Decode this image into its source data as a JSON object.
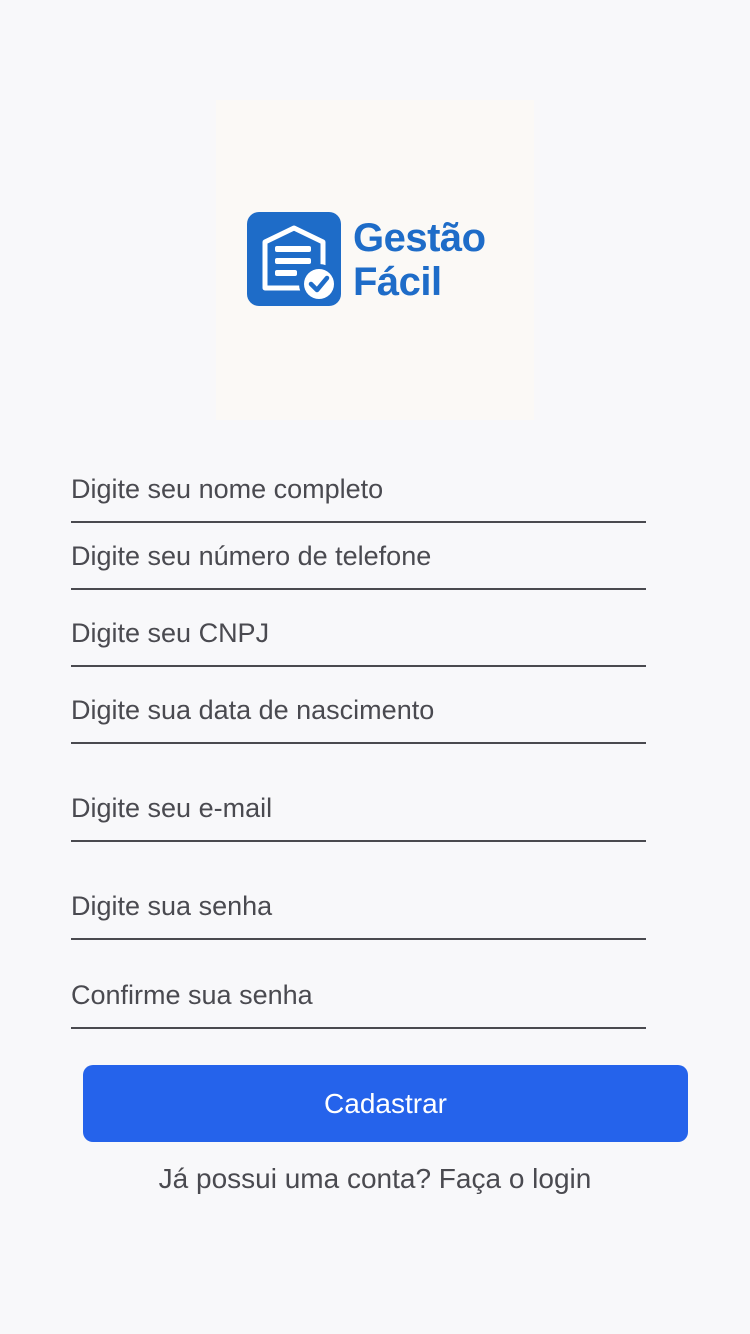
{
  "brand": {
    "name_line1": "Gestão",
    "name_line2": "Fácil",
    "color": "#1e6cc8",
    "icon": "document-check-icon"
  },
  "form": {
    "fields": [
      {
        "placeholder": "Digite seu nome completo",
        "value": ""
      },
      {
        "placeholder": "Digite seu número de telefone",
        "value": ""
      },
      {
        "placeholder": "Digite seu CNPJ",
        "value": ""
      },
      {
        "placeholder": "Digite sua data de nascimento",
        "value": ""
      },
      {
        "placeholder": "Digite seu e-mail",
        "value": ""
      },
      {
        "placeholder": "Digite sua senha",
        "value": ""
      },
      {
        "placeholder": "Confirme sua senha",
        "value": ""
      }
    ],
    "submit_label": "Cadastrar",
    "submit_color": "#2563eb"
  },
  "footer": {
    "login_text": "Já possui uma conta? Faça o login"
  }
}
